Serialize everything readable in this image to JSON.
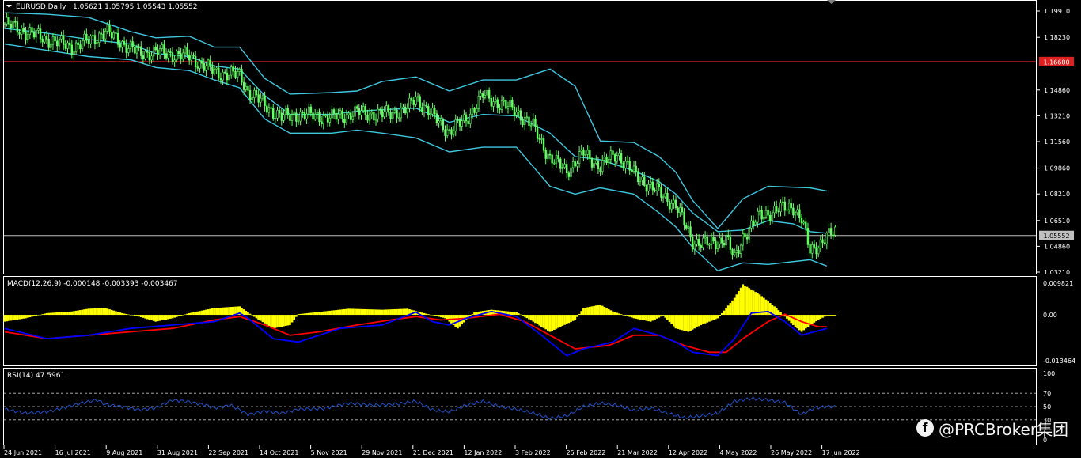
{
  "chart_data": [
    {
      "type": "candlestick",
      "title": "EURUSD,Daily",
      "ohlc_label": "1.05621 1.05795 1.05543 1.05552",
      "y_ticks": [
        "1.19910",
        "1.18230",
        "1.16580",
        "1.14860",
        "1.13210",
        "1.11560",
        "1.09860",
        "1.08210",
        "1.06510",
        "1.04860",
        "1.03210"
      ],
      "ylim": [
        1.0321,
        1.1991
      ],
      "horizontal_lines": [
        {
          "value": 1.1668,
          "label": "1.16680",
          "color": "#e02020"
        },
        {
          "value": 1.05552,
          "label": "1.05552",
          "color": "#c0c0c0"
        }
      ],
      "x_labels": [
        "24 Jun 2021",
        "16 Jul 2021",
        "9 Aug 2021",
        "31 Aug 2021",
        "22 Sep 2021",
        "14 Oct 2021",
        "5 Nov 2021",
        "29 Nov 2021",
        "21 Dec 2021",
        "12 Jan 2022",
        "3 Feb 2022",
        "25 Feb 2022",
        "21 Mar 2022",
        "12 Apr 2022",
        "4 May 2022",
        "26 May 2022",
        "17 Jun 2022"
      ],
      "close_path": [
        [
          0,
          1.191
        ],
        [
          16,
          1.183
        ],
        [
          32,
          1.176
        ],
        [
          40,
          1.18
        ],
        [
          48,
          1.186
        ],
        [
          58,
          1.177
        ],
        [
          64,
          1.172
        ],
        [
          72,
          1.173
        ],
        [
          88,
          1.17
        ],
        [
          100,
          1.16
        ],
        [
          112,
          1.158
        ],
        [
          116,
          1.148
        ],
        [
          124,
          1.139
        ],
        [
          132,
          1.131
        ],
        [
          140,
          1.133
        ],
        [
          156,
          1.131
        ],
        [
          168,
          1.134
        ],
        [
          180,
          1.133
        ],
        [
          192,
          1.136
        ],
        [
          196,
          1.144
        ],
        [
          204,
          1.132
        ],
        [
          212,
          1.122
        ],
        [
          220,
          1.13
        ],
        [
          228,
          1.145
        ],
        [
          236,
          1.14
        ],
        [
          244,
          1.135
        ],
        [
          252,
          1.125
        ],
        [
          260,
          1.105
        ],
        [
          268,
          1.097
        ],
        [
          276,
          1.108
        ],
        [
          284,
          1.1
        ],
        [
          292,
          1.108
        ],
        [
          300,
          1.095
        ],
        [
          310,
          1.085
        ],
        [
          320,
          1.075
        ],
        [
          328,
          1.052
        ],
        [
          336,
          1.05
        ],
        [
          344,
          1.054
        ],
        [
          348,
          1.04
        ],
        [
          352,
          1.055
        ],
        [
          360,
          1.068
        ],
        [
          368,
          1.072
        ],
        [
          376,
          1.074
        ],
        [
          380,
          1.066
        ],
        [
          384,
          1.045
        ],
        [
          388,
          1.05
        ],
        [
          392,
          1.055
        ],
        [
          396,
          1.057
        ]
      ],
      "bollinger_upper": [
        [
          0,
          1.198
        ],
        [
          20,
          1.197
        ],
        [
          40,
          1.195
        ],
        [
          60,
          1.186
        ],
        [
          72,
          1.182
        ],
        [
          88,
          1.183
        ],
        [
          100,
          1.176
        ],
        [
          112,
          1.176
        ],
        [
          124,
          1.156
        ],
        [
          136,
          1.146
        ],
        [
          156,
          1.147
        ],
        [
          168,
          1.148
        ],
        [
          180,
          1.154
        ],
        [
          196,
          1.157
        ],
        [
          212,
          1.148
        ],
        [
          228,
          1.155
        ],
        [
          244,
          1.155
        ],
        [
          260,
          1.162
        ],
        [
          272,
          1.151
        ],
        [
          284,
          1.116
        ],
        [
          300,
          1.115
        ],
        [
          312,
          1.106
        ],
        [
          320,
          1.096
        ],
        [
          328,
          1.078
        ],
        [
          340,
          1.06
        ],
        [
          352,
          1.079
        ],
        [
          364,
          1.087
        ],
        [
          384,
          1.086
        ],
        [
          392,
          1.084
        ]
      ],
      "bollinger_mid": [
        [
          0,
          1.188
        ],
        [
          20,
          1.185
        ],
        [
          40,
          1.181
        ],
        [
          60,
          1.178
        ],
        [
          72,
          1.172
        ],
        [
          88,
          1.17
        ],
        [
          100,
          1.164
        ],
        [
          112,
          1.162
        ],
        [
          124,
          1.145
        ],
        [
          136,
          1.133
        ],
        [
          156,
          1.133
        ],
        [
          168,
          1.135
        ],
        [
          180,
          1.136
        ],
        [
          196,
          1.137
        ],
        [
          212,
          1.128
        ],
        [
          228,
          1.133
        ],
        [
          244,
          1.132
        ],
        [
          260,
          1.121
        ],
        [
          272,
          1.106
        ],
        [
          284,
          1.104
        ],
        [
          300,
          1.097
        ],
        [
          312,
          1.09
        ],
        [
          320,
          1.082
        ],
        [
          328,
          1.07
        ],
        [
          340,
          1.058
        ],
        [
          352,
          1.059
        ],
        [
          364,
          1.065
        ],
        [
          376,
          1.063
        ],
        [
          384,
          1.058
        ],
        [
          392,
          1.057
        ]
      ],
      "bollinger_lower": [
        [
          0,
          1.178
        ],
        [
          20,
          1.174
        ],
        [
          40,
          1.17
        ],
        [
          60,
          1.168
        ],
        [
          72,
          1.163
        ],
        [
          88,
          1.161
        ],
        [
          100,
          1.155
        ],
        [
          112,
          1.15
        ],
        [
          124,
          1.13
        ],
        [
          136,
          1.121
        ],
        [
          156,
          1.121
        ],
        [
          168,
          1.123
        ],
        [
          180,
          1.121
        ],
        [
          196,
          1.118
        ],
        [
          212,
          1.109
        ],
        [
          228,
          1.112
        ],
        [
          244,
          1.112
        ],
        [
          260,
          1.087
        ],
        [
          272,
          1.082
        ],
        [
          284,
          1.086
        ],
        [
          300,
          1.082
        ],
        [
          312,
          1.07
        ],
        [
          320,
          1.061
        ],
        [
          328,
          1.048
        ],
        [
          340,
          1.033
        ],
        [
          352,
          1.038
        ],
        [
          364,
          1.037
        ],
        [
          384,
          1.04
        ],
        [
          392,
          1.036
        ]
      ]
    },
    {
      "type": "bar+line",
      "label": "MACD(12,26,9) -0.000148 -0.003393 -0.003467",
      "y_ticks": [
        "0.009821",
        "0.00",
        "-0.013464"
      ],
      "ylim": [
        -0.0135,
        0.0098
      ],
      "histogram": [
        [
          0,
          -0.002
        ],
        [
          10,
          -0.001
        ],
        [
          20,
          0.0005
        ],
        [
          32,
          0.001
        ],
        [
          40,
          0.0018
        ],
        [
          48,
          0.002
        ],
        [
          56,
          0.0005
        ],
        [
          64,
          -0.0005
        ],
        [
          72,
          -0.002
        ],
        [
          80,
          -0.001
        ],
        [
          88,
          0.0005
        ],
        [
          100,
          0.002
        ],
        [
          112,
          0.0025
        ],
        [
          120,
          -0.001
        ],
        [
          128,
          -0.004
        ],
        [
          136,
          -0.003
        ],
        [
          140,
          0.0002
        ],
        [
          152,
          0.001
        ],
        [
          164,
          0.0018
        ],
        [
          180,
          0.0015
        ],
        [
          192,
          0.0018
        ],
        [
          200,
          0.0005
        ],
        [
          210,
          -0.001
        ],
        [
          216,
          -0.004
        ],
        [
          224,
          0.0008
        ],
        [
          232,
          0.0015
        ],
        [
          244,
          0.0008
        ],
        [
          252,
          -0.002
        ],
        [
          260,
          -0.005
        ],
        [
          272,
          -0.0015
        ],
        [
          276,
          0.002
        ],
        [
          284,
          0.003
        ],
        [
          290,
          0.001
        ],
        [
          300,
          -0.001
        ],
        [
          308,
          -0.002
        ],
        [
          314,
          -0.0002
        ],
        [
          320,
          -0.004
        ],
        [
          326,
          -0.005
        ],
        [
          332,
          -0.003
        ],
        [
          340,
          -0.001
        ],
        [
          348,
          0.005
        ],
        [
          352,
          0.009
        ],
        [
          360,
          0.006
        ],
        [
          368,
          0.002
        ],
        [
          376,
          -0.003
        ],
        [
          380,
          -0.005
        ],
        [
          384,
          -0.003
        ],
        [
          388,
          -0.0015
        ],
        [
          392,
          -0.0002
        ]
      ],
      "macd_line": [
        [
          0,
          -0.004
        ],
        [
          20,
          -0.007
        ],
        [
          40,
          -0.006
        ],
        [
          60,
          -0.004
        ],
        [
          80,
          -0.003
        ],
        [
          100,
          -0.002
        ],
        [
          112,
          0.0005
        ],
        [
          116,
          -0.001
        ],
        [
          128,
          -0.007
        ],
        [
          140,
          -0.008
        ],
        [
          160,
          -0.004
        ],
        [
          180,
          -0.003
        ],
        [
          196,
          0.0008
        ],
        [
          204,
          -0.002
        ],
        [
          212,
          -0.003
        ],
        [
          220,
          -0.001
        ],
        [
          232,
          0.001
        ],
        [
          244,
          -0.0005
        ],
        [
          256,
          -0.006
        ],
        [
          268,
          -0.012
        ],
        [
          276,
          -0.01
        ],
        [
          290,
          -0.008
        ],
        [
          300,
          -0.004
        ],
        [
          312,
          -0.006
        ],
        [
          320,
          -0.008
        ],
        [
          328,
          -0.011
        ],
        [
          340,
          -0.012
        ],
        [
          348,
          -0.007
        ],
        [
          356,
          0.0005
        ],
        [
          364,
          0.001
        ],
        [
          372,
          -0.002
        ],
        [
          380,
          -0.006
        ],
        [
          392,
          -0.004
        ]
      ],
      "signal_line": [
        [
          0,
          -0.005
        ],
        [
          20,
          -0.007
        ],
        [
          40,
          -0.006
        ],
        [
          60,
          -0.005
        ],
        [
          80,
          -0.004
        ],
        [
          100,
          -0.0015
        ],
        [
          112,
          -0.0005
        ],
        [
          124,
          -0.003
        ],
        [
          136,
          -0.006
        ],
        [
          150,
          -0.005
        ],
        [
          168,
          -0.003
        ],
        [
          184,
          -0.0015
        ],
        [
          196,
          -0.0005
        ],
        [
          208,
          -0.0015
        ],
        [
          220,
          -0.001
        ],
        [
          236,
          0.0002
        ],
        [
          248,
          -0.002
        ],
        [
          260,
          -0.006
        ],
        [
          272,
          -0.01
        ],
        [
          288,
          -0.009
        ],
        [
          300,
          -0.006
        ],
        [
          312,
          -0.006
        ],
        [
          324,
          -0.009
        ],
        [
          336,
          -0.011
        ],
        [
          344,
          -0.011
        ],
        [
          352,
          -0.007
        ],
        [
          364,
          -0.002
        ],
        [
          372,
          0.0002
        ],
        [
          380,
          -0.002
        ],
        [
          388,
          -0.0035
        ],
        [
          392,
          -0.0035
        ]
      ]
    },
    {
      "type": "line",
      "label": "RSI(14) 47.5961",
      "y_ticks": [
        "100",
        "70",
        "50",
        "30",
        "0"
      ],
      "ylim": [
        0,
        100
      ],
      "levels": [
        70,
        50,
        30
      ],
      "values": [
        [
          0,
          46
        ],
        [
          10,
          40
        ],
        [
          20,
          42
        ],
        [
          28,
          48
        ],
        [
          36,
          55
        ],
        [
          44,
          60
        ],
        [
          48,
          53
        ],
        [
          56,
          50
        ],
        [
          64,
          45
        ],
        [
          72,
          48
        ],
        [
          80,
          60
        ],
        [
          88,
          57
        ],
        [
          96,
          52
        ],
        [
          100,
          48
        ],
        [
          108,
          52
        ],
        [
          116,
          38
        ],
        [
          124,
          43
        ],
        [
          132,
          40
        ],
        [
          140,
          46
        ],
        [
          152,
          47
        ],
        [
          164,
          55
        ],
        [
          176,
          52
        ],
        [
          188,
          54
        ],
        [
          196,
          58
        ],
        [
          204,
          45
        ],
        [
          212,
          42
        ],
        [
          220,
          52
        ],
        [
          228,
          58
        ],
        [
          236,
          50
        ],
        [
          244,
          46
        ],
        [
          252,
          40
        ],
        [
          260,
          32
        ],
        [
          268,
          36
        ],
        [
          276,
          50
        ],
        [
          284,
          55
        ],
        [
          292,
          52
        ],
        [
          300,
          44
        ],
        [
          308,
          48
        ],
        [
          316,
          40
        ],
        [
          324,
          33
        ],
        [
          332,
          36
        ],
        [
          340,
          40
        ],
        [
          348,
          58
        ],
        [
          356,
          62
        ],
        [
          364,
          60
        ],
        [
          372,
          56
        ],
        [
          380,
          38
        ],
        [
          386,
          48
        ],
        [
          392,
          50
        ]
      ]
    }
  ],
  "watermark": {
    "fb_glyph": "f",
    "text": "@PRCBroker集团"
  },
  "colors": {
    "bull": "#66ff66",
    "bollinger": "#3ec7de",
    "macd_hist": "#ffff00",
    "macd_main": "#0000ff",
    "macd_signal": "#ff0000",
    "rsi": "#2050c8",
    "text": "#ffffff",
    "grid": "#ffffff"
  }
}
